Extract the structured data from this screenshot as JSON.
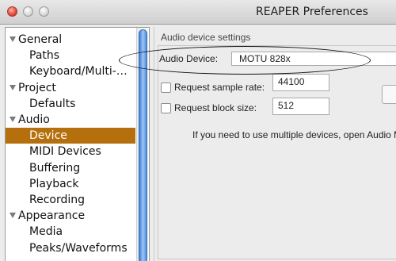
{
  "window": {
    "title": "REAPER Preferences"
  },
  "sidebar": {
    "items": [
      {
        "label": "General",
        "level": "top",
        "expanded": true
      },
      {
        "label": "Paths",
        "level": "child"
      },
      {
        "label": "Keyboard/Multi-…",
        "level": "child"
      },
      {
        "label": "Project",
        "level": "top",
        "expanded": true
      },
      {
        "label": "Defaults",
        "level": "child"
      },
      {
        "label": "Audio",
        "level": "top",
        "expanded": true
      },
      {
        "label": "Device",
        "level": "child",
        "selected": true
      },
      {
        "label": "MIDI Devices",
        "level": "child"
      },
      {
        "label": "Buffering",
        "level": "child"
      },
      {
        "label": "Playback",
        "level": "child"
      },
      {
        "label": "Recording",
        "level": "child"
      },
      {
        "label": "Appearance",
        "level": "top",
        "expanded": true
      },
      {
        "label": "Media",
        "level": "child"
      },
      {
        "label": "Peaks/Waveforms",
        "level": "child"
      }
    ],
    "selected_color": "#b5700d"
  },
  "panel": {
    "group_label": "Audio device settings",
    "audio_device": {
      "label": "Audio Device:",
      "value": "MOTU 828x"
    },
    "request_sample_rate": {
      "label": "Request sample rate:",
      "value": "44100",
      "checked": false
    },
    "request_block_size": {
      "label": "Request block size:",
      "value": "512",
      "checked": false
    },
    "info_text": "If you need to use multiple devices, open Audio M"
  }
}
